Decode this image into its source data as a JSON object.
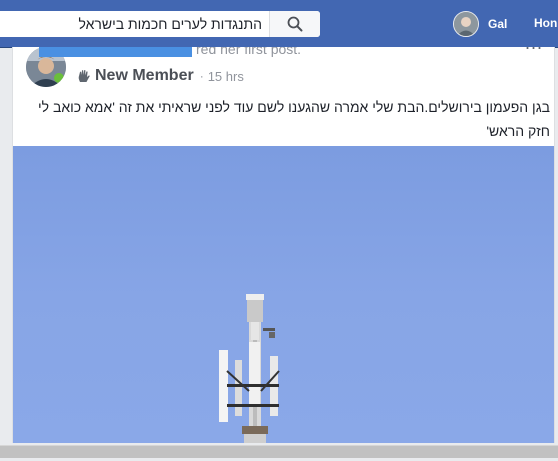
{
  "search": {
    "value": "התנגדות לערים חכמות בישראל",
    "icon": "search-icon"
  },
  "user": {
    "name": "Gal",
    "home_label": "Hon"
  },
  "post": {
    "header_suffix": "red her first post.",
    "badge_label": "New Member",
    "badge_icon": "wave-hand-icon",
    "separator": "·",
    "time": "15 hrs",
    "more": "...",
    "text": "בגן הפעמון בירושלים.הבת שלי אמרה שהגענו לשם עוד לפני שראיתי את זה 'אמא כואב לי חזק הראש'",
    "photo_subject": "cell-tower-image"
  },
  "colors": {
    "topbar": "#4267b2",
    "sky": "#7f9fe0",
    "redaction": "#4a90e2"
  }
}
